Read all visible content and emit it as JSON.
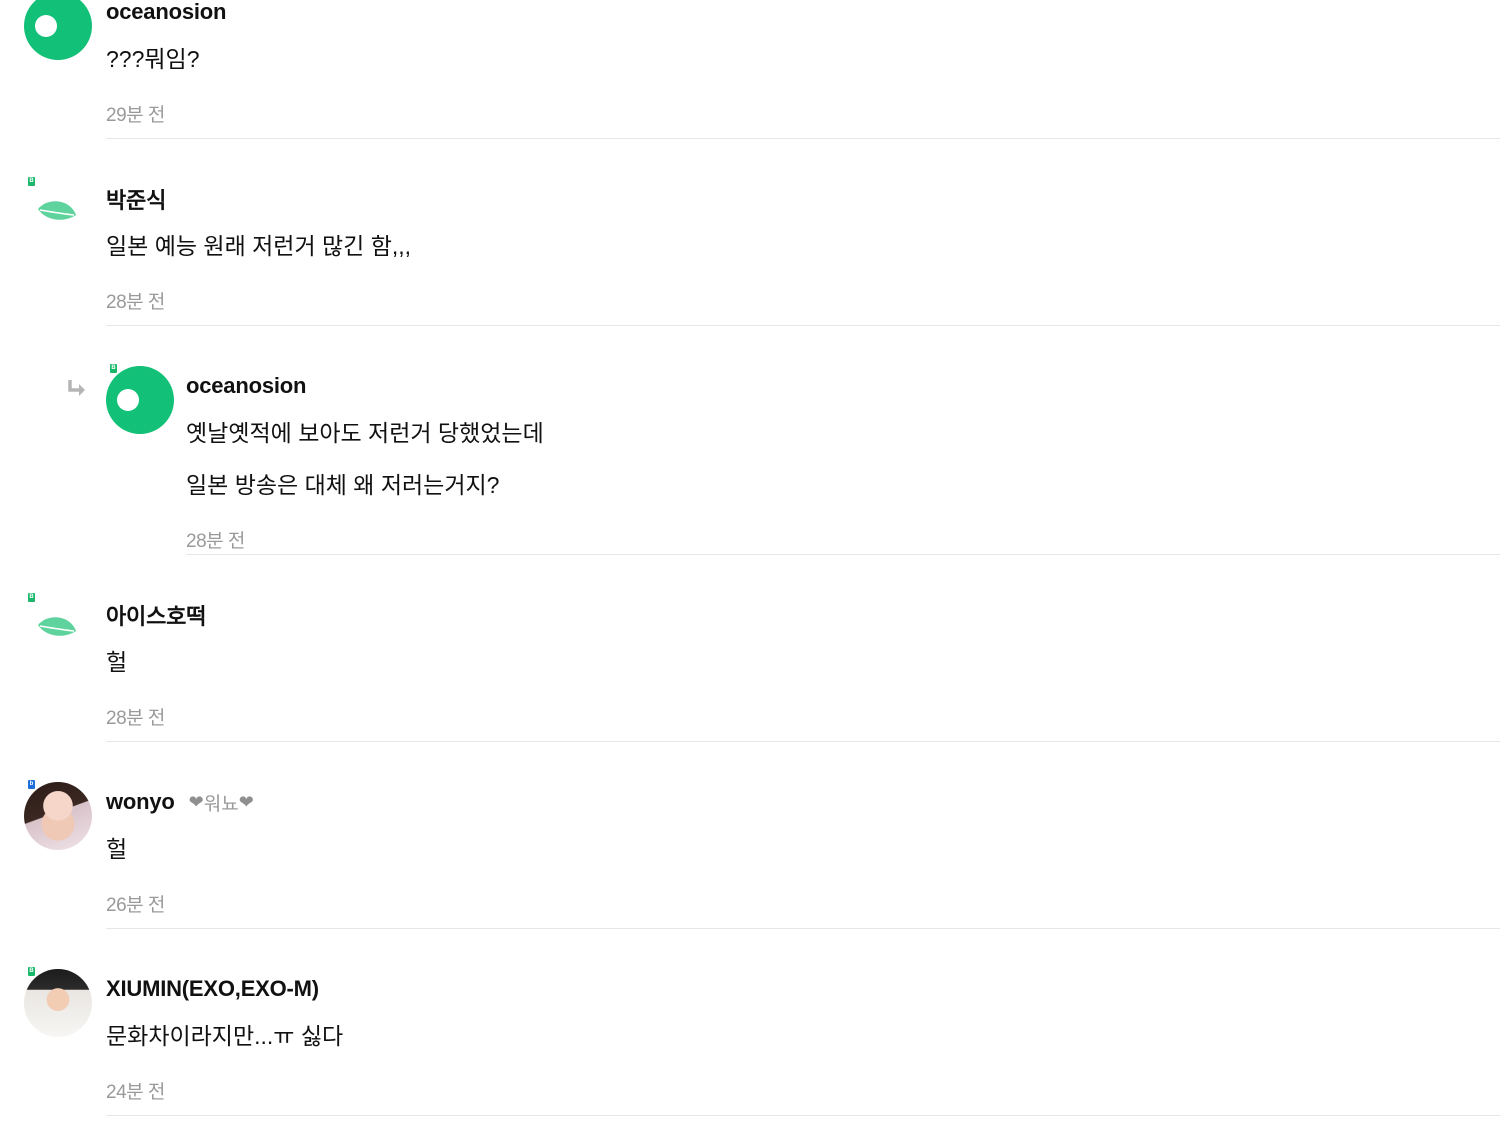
{
  "comments": [
    {
      "avatar": "green-circle-default",
      "author": "oceanosion",
      "tag": "",
      "lines": [
        "???뭐임?"
      ],
      "time": "29분 전",
      "is_reply": false
    },
    {
      "avatar": "leaf-default",
      "author": "박준식",
      "tag": "",
      "lines": [
        "일본 예능 원래 저런거 많긴 함,,,"
      ],
      "time": "28분 전",
      "is_reply": false
    },
    {
      "avatar": "green-circle-default",
      "author": "oceanosion",
      "tag": "",
      "lines": [
        "옛날옛적에 보아도 저런거 당했었는데",
        "일본 방송은 대체 왜 저러는거지?"
      ],
      "time": "28분 전",
      "is_reply": true
    },
    {
      "avatar": "leaf-default",
      "author": "아이스호떡",
      "tag": "",
      "lines": [
        "헐"
      ],
      "time": "28분 전",
      "is_reply": false
    },
    {
      "avatar": "photo-girl",
      "author": "wonyo",
      "tag": "워뇨",
      "lines": [
        "헐"
      ],
      "time": "26분 전",
      "is_reply": false
    },
    {
      "avatar": "photo-boy",
      "author": "XIUMIN(EXO,EXO-M)",
      "tag": "",
      "lines": [
        "문화차이라지만...ㅠ 싫다"
      ],
      "time": "24분 전",
      "is_reply": false
    }
  ],
  "badges": [
    "B",
    "B",
    "B",
    "B",
    "b",
    "B"
  ],
  "colors": {
    "brand_green": "#12c078",
    "leaf_green": "#5fd39d",
    "muted_text": "#9a9a9a",
    "divider": "#e6e6e6"
  },
  "icons": {
    "reply": "reply-arrow-icon",
    "heart": "heart-icon",
    "leaf": "leaf-icon"
  }
}
